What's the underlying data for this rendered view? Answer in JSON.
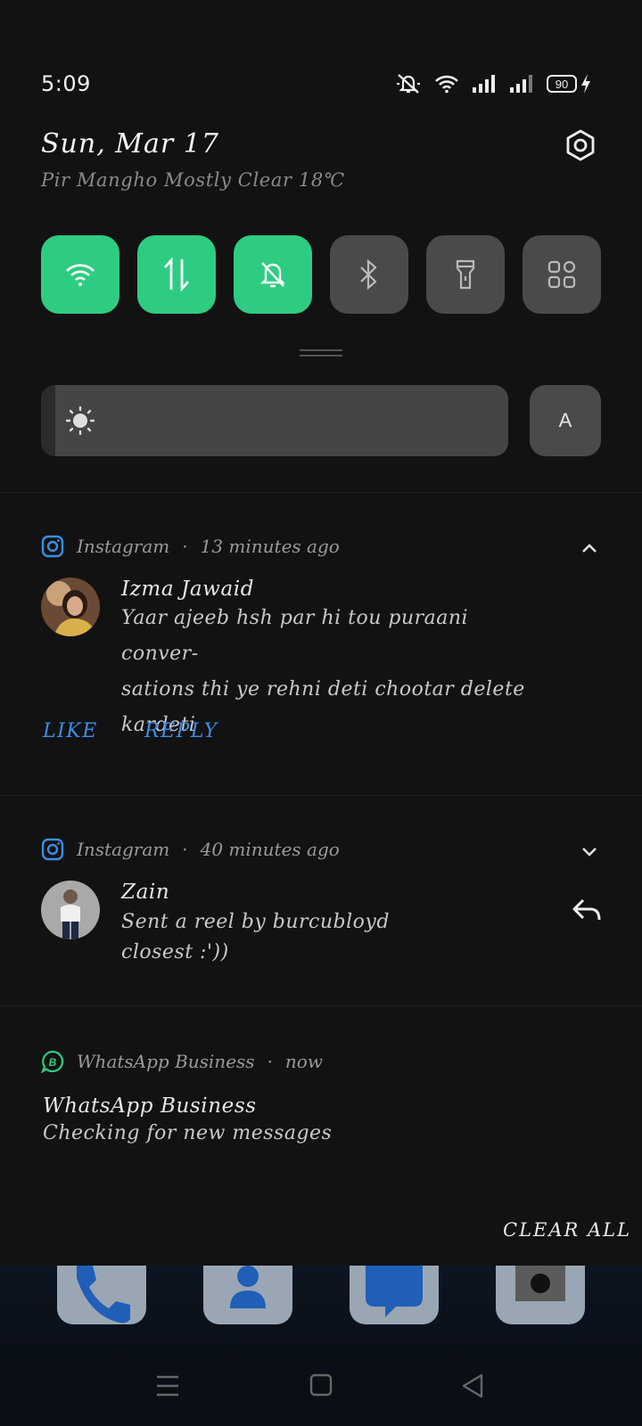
{
  "status_bar": {
    "time": "5:09",
    "battery_level": "90",
    "icons": [
      "mute-icon",
      "wifi-icon",
      "signal-icon",
      "signal-icon",
      "battery-icon",
      "charging-icon"
    ]
  },
  "header": {
    "date": "Sun, Mar 17",
    "weather": "Pir Mangho Mostly Clear 18℃"
  },
  "quick_tiles": [
    {
      "name": "wifi",
      "state": "on"
    },
    {
      "name": "mobile-data",
      "state": "on"
    },
    {
      "name": "silent",
      "state": "on"
    },
    {
      "name": "bluetooth",
      "state": "off"
    },
    {
      "name": "flashlight",
      "state": "off"
    },
    {
      "name": "edit-tiles",
      "state": "off"
    }
  ],
  "brightness": {
    "level_fraction": 0.03,
    "auto_label": "A"
  },
  "notifications": [
    {
      "app": "Instagram",
      "time": "13 minutes ago",
      "sender": "Izma Jawaid",
      "body_lines": [
        "Yaar ajeeb hsh par hi tou puraani conver-",
        "sations thi ye rehni deti chootar delete",
        "kardeti"
      ],
      "actions": [
        "LIKE",
        "REPLY"
      ],
      "expanded": true
    },
    {
      "app": "Instagram",
      "time": "40 minutes ago",
      "sender": "Zain",
      "body_lines": [
        "Sent a reel by burcubloyd",
        "closest :'))"
      ],
      "expanded": false
    },
    {
      "app": "WhatsApp Business",
      "time": "now",
      "title": "WhatsApp Business",
      "body_lines": [
        "Checking for new messages"
      ]
    }
  ],
  "clear_all_label": "CLEAR ALL",
  "colors": {
    "tile_on": "#2ecc82",
    "tile_off": "#4a4a4a",
    "action_blue": "#3a8ee6",
    "background": "#121212"
  }
}
